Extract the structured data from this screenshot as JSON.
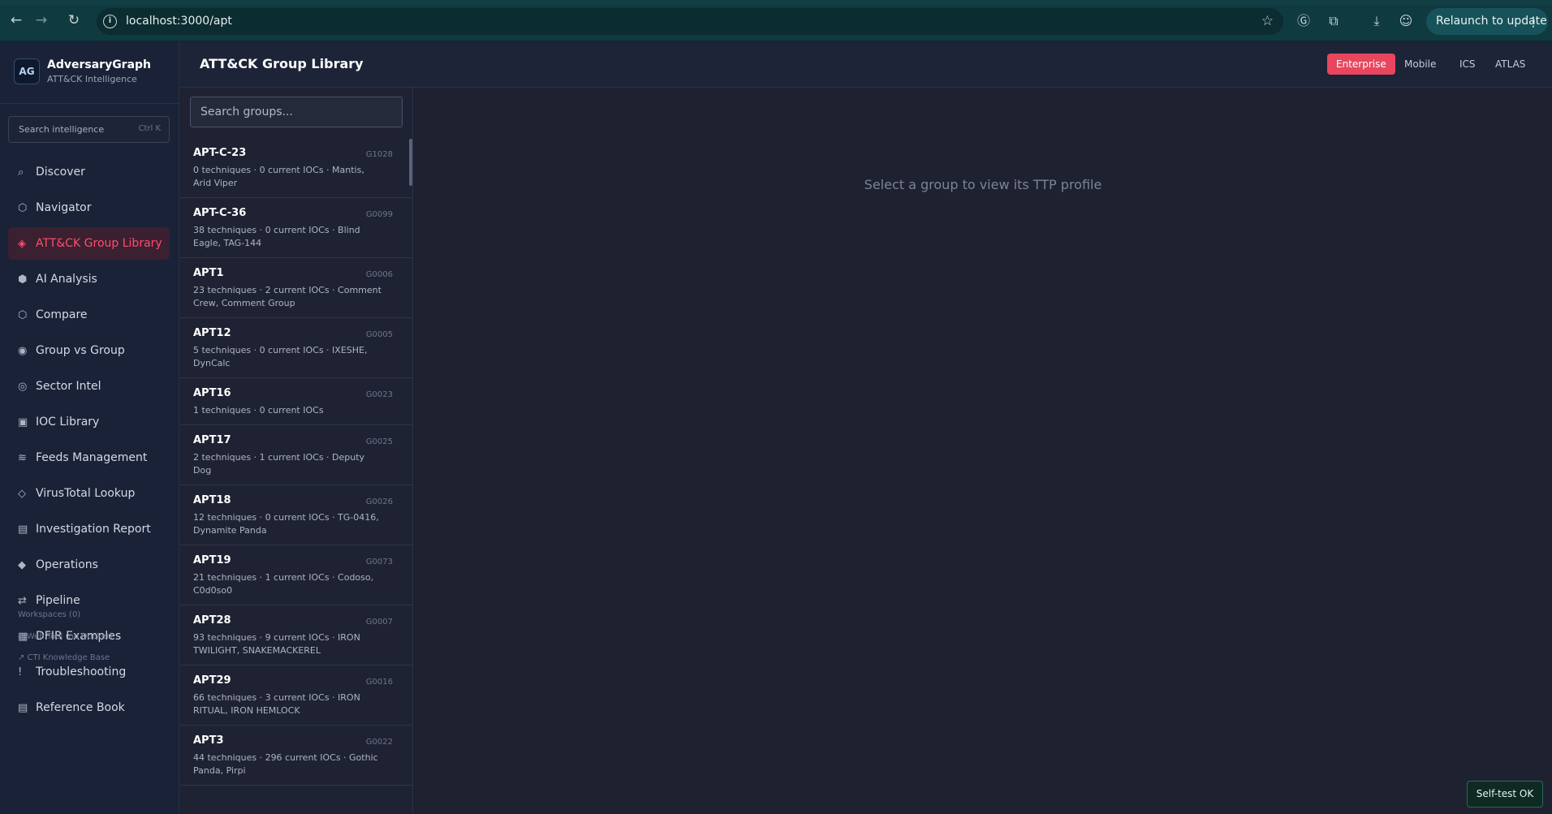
{
  "browser": {
    "url": "localhost:3000/apt",
    "relaunch_label": "Relaunch to update"
  },
  "sidebar": {
    "brand_name": "AdversaryGraph",
    "brand_sub": "ATT&CK Intelligence",
    "logo_text": "AG",
    "search_placeholder": "Search intelligence",
    "search_shortcut": "Ctrl K",
    "items": [
      {
        "icon": "⌕",
        "label": "Discover"
      },
      {
        "icon": "⬡",
        "label": "Navigator"
      },
      {
        "icon": "◈",
        "label": "ATT&CK Group Library"
      },
      {
        "icon": "⬢",
        "label": "AI Analysis"
      },
      {
        "icon": "⬡",
        "label": "Compare"
      },
      {
        "icon": "◉",
        "label": "Group vs Group"
      },
      {
        "icon": "◎",
        "label": "Sector Intel"
      },
      {
        "icon": "▣",
        "label": "IOC Library"
      },
      {
        "icon": "≋",
        "label": "Feeds Management"
      },
      {
        "icon": "◇",
        "label": "VirusTotal Lookup"
      },
      {
        "icon": "▤",
        "label": "Investigation Report"
      },
      {
        "icon": "◆",
        "label": "Operations"
      },
      {
        "icon": "⇄",
        "label": "Pipeline"
      },
      {
        "icon": "▦",
        "label": "DFIR Examples"
      },
      {
        "icon": "!",
        "label": "Troubleshooting"
      },
      {
        "icon": "▤",
        "label": "Reference Book"
      }
    ],
    "workspaces": "Workspaces (0)",
    "web_tool": "◈ Web Tool (no Docker)",
    "cti_kb": "↗ CTI Knowledge Base"
  },
  "header": {
    "title": "ATT&CK Group Library",
    "tabs": [
      "Enterprise",
      "Mobile",
      "ICS",
      "ATLAS"
    ]
  },
  "groups": {
    "search_placeholder": "Search groups...",
    "items": [
      {
        "name": "APT-C-23",
        "id": "G1028",
        "meta": "0 techniques · 0 current IOCs · Mantis, Arid Viper"
      },
      {
        "name": "APT-C-36",
        "id": "G0099",
        "meta": "38 techniques · 0 current IOCs · Blind Eagle, TAG-144"
      },
      {
        "name": "APT1",
        "id": "G0006",
        "meta": "23 techniques · 2 current IOCs · Comment Crew, Comment Group"
      },
      {
        "name": "APT12",
        "id": "G0005",
        "meta": "5 techniques · 0 current IOCs · IXESHE, DynCalc"
      },
      {
        "name": "APT16",
        "id": "G0023",
        "meta": "1 techniques · 0 current IOCs"
      },
      {
        "name": "APT17",
        "id": "G0025",
        "meta": "2 techniques · 1 current IOCs · Deputy Dog"
      },
      {
        "name": "APT18",
        "id": "G0026",
        "meta": "12 techniques · 0 current IOCs · TG-0416, Dynamite Panda"
      },
      {
        "name": "APT19",
        "id": "G0073",
        "meta": "21 techniques · 1 current IOCs · Codoso, C0d0so0"
      },
      {
        "name": "APT28",
        "id": "G0007",
        "meta": "93 techniques · 9 current IOCs · IRON TWILIGHT, SNAKEMACKEREL"
      },
      {
        "name": "APT29",
        "id": "G0016",
        "meta": "66 techniques · 3 current IOCs · IRON RITUAL, IRON HEMLOCK"
      },
      {
        "name": "APT3",
        "id": "G0022",
        "meta": "44 techniques · 296 current IOCs · Gothic Panda, Pirpi"
      }
    ]
  },
  "main": {
    "empty_text": "Select a group to view its TTP profile",
    "selftest": "Self-test OK"
  }
}
